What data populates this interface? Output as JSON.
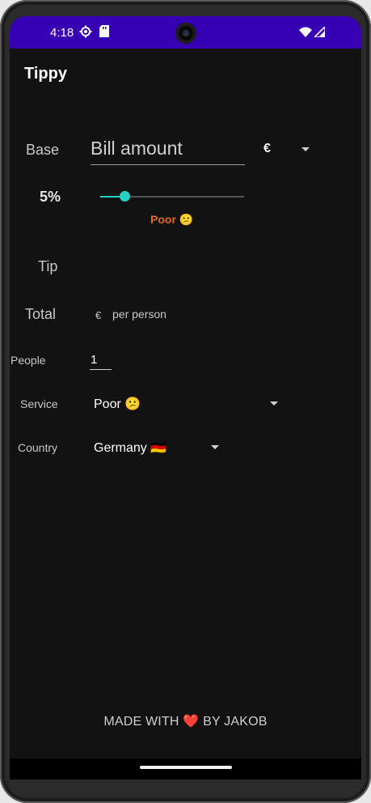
{
  "status_bar": {
    "time": "4:18",
    "icons": [
      "settings-gear-icon",
      "sd-card-icon",
      "wifi-icon",
      "cellular-signal-icon"
    ],
    "background_color": "#3700b3"
  },
  "app": {
    "title": "Tippy"
  },
  "base": {
    "label": "Base",
    "input_placeholder": "Bill amount",
    "currency": "€"
  },
  "tip_slider": {
    "percent_label": "5%",
    "value_fraction": 0.17,
    "description": "Poor 😕",
    "accent_color": "#26d0c4",
    "description_color": "#e06a1b"
  },
  "tip": {
    "label": "Tip",
    "amount": ""
  },
  "total": {
    "label": "Total",
    "currency": "€",
    "suffix": "per person"
  },
  "people": {
    "label": "People",
    "value": "1"
  },
  "service": {
    "label": "Service",
    "selected": "Poor 😕"
  },
  "country": {
    "label": "Country",
    "selected": "Germany 🇩🇪"
  },
  "footer": {
    "text": "MADE WITH ❤️ BY JAKOB"
  }
}
